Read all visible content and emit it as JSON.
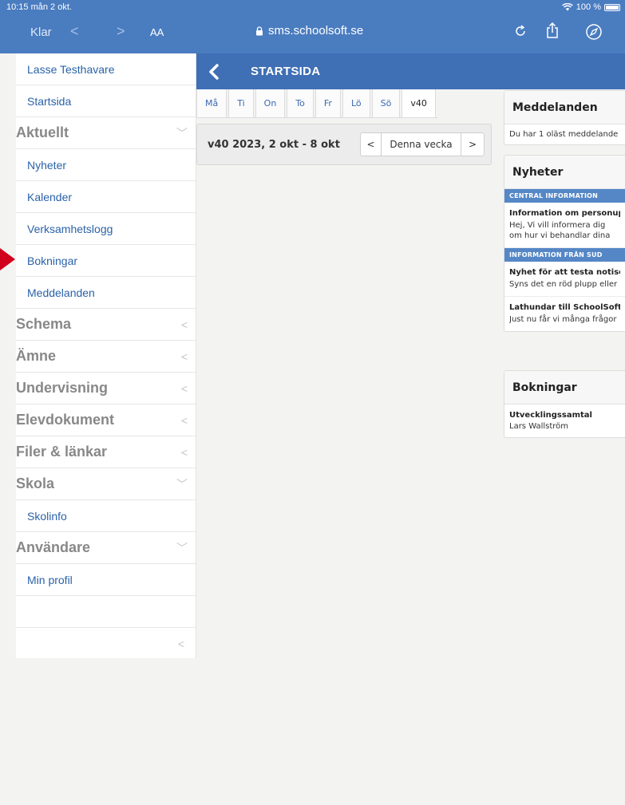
{
  "status_bar": {
    "time": "10:15  mån 2 okt.",
    "battery": "100 %"
  },
  "browser": {
    "done": "Klar",
    "back": "<",
    "forward": ">",
    "text_size": "AA",
    "url": "sms.schoolsoft.se"
  },
  "sidebar": {
    "user": "Lasse Testhavare",
    "items": [
      {
        "type": "link",
        "label": "Startsida"
      },
      {
        "type": "head",
        "label": "Aktuellt",
        "chevron": "﹀"
      },
      {
        "type": "link",
        "label": "Nyheter"
      },
      {
        "type": "link",
        "label": "Kalender"
      },
      {
        "type": "link",
        "label": "Verksamhetslogg"
      },
      {
        "type": "link",
        "label": "Bokningar"
      },
      {
        "type": "link",
        "label": "Meddelanden"
      },
      {
        "type": "head",
        "label": "Schema",
        "chevron": "<"
      },
      {
        "type": "head",
        "label": "Ämne",
        "chevron": "<"
      },
      {
        "type": "head",
        "label": "Undervisning",
        "chevron": "<"
      },
      {
        "type": "head",
        "label": "Elevdokument",
        "chevron": "<"
      },
      {
        "type": "head",
        "label": "Filer & länkar",
        "chevron": "<"
      },
      {
        "type": "head",
        "label": "Skola",
        "chevron": "﹀"
      },
      {
        "type": "link",
        "label": "Skolinfo"
      },
      {
        "type": "head",
        "label": "Användare",
        "chevron": "﹀"
      },
      {
        "type": "link",
        "label": "Min profil"
      }
    ],
    "collapse": "<"
  },
  "header": {
    "title": "STARTSIDA"
  },
  "day_tabs": [
    "Må",
    "Ti",
    "On",
    "To",
    "Fr",
    "Lö",
    "Sö",
    "v40"
  ],
  "week": {
    "label": "v40 2023, 2 okt - 8 okt",
    "prev": "<",
    "today": "Denna vecka",
    "next": ">"
  },
  "messages": {
    "title": "Meddelanden",
    "text": "Du har 1 oläst meddelande"
  },
  "news": {
    "title": "Nyheter",
    "groups": [
      {
        "category": "CENTRAL INFORMATION",
        "items": [
          {
            "title": "Information om personuppgifter",
            "excerpt": "Hej, Vi vill informera dig om hur vi behandlar dina personuppgifter p..."
          }
        ]
      },
      {
        "category": "INFORMATION FRÅN SUD",
        "items": [
          {
            "title": "Nyhet för att testa notiser",
            "excerpt": "Syns det en röd plupp eller inte?"
          },
          {
            "title": "Lathundar till SchoolSoft",
            "excerpt": "Just nu får vi många frågor"
          }
        ]
      }
    ]
  },
  "bookings": {
    "title": "Bokningar",
    "item_title": "Utvecklingssamtal",
    "item_sub": "Lars Wallström"
  },
  "colors": {
    "topbar": "#4a7cc0",
    "header": "#3f6fb5",
    "link": "#2a62a8",
    "pointer": "#d0021b"
  }
}
